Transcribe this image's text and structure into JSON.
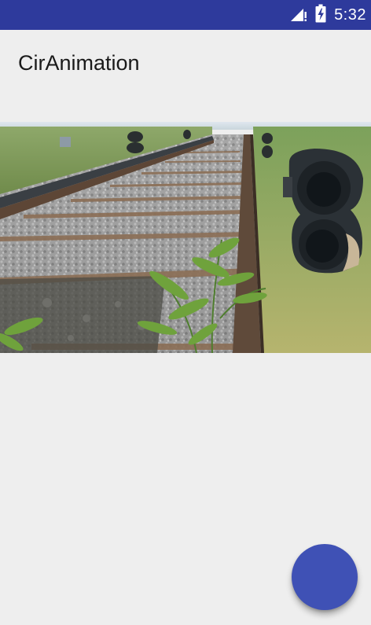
{
  "status_bar": {
    "time": "5:32",
    "icons": [
      "signal-no-data-icon",
      "battery-charging-icon"
    ],
    "background_color": "#2e3a9c"
  },
  "app_bar": {
    "title": "CirAnimation"
  },
  "content": {
    "image_subject": "railway-track-with-signal-photo"
  },
  "fab": {
    "color": "#3f51b5"
  }
}
